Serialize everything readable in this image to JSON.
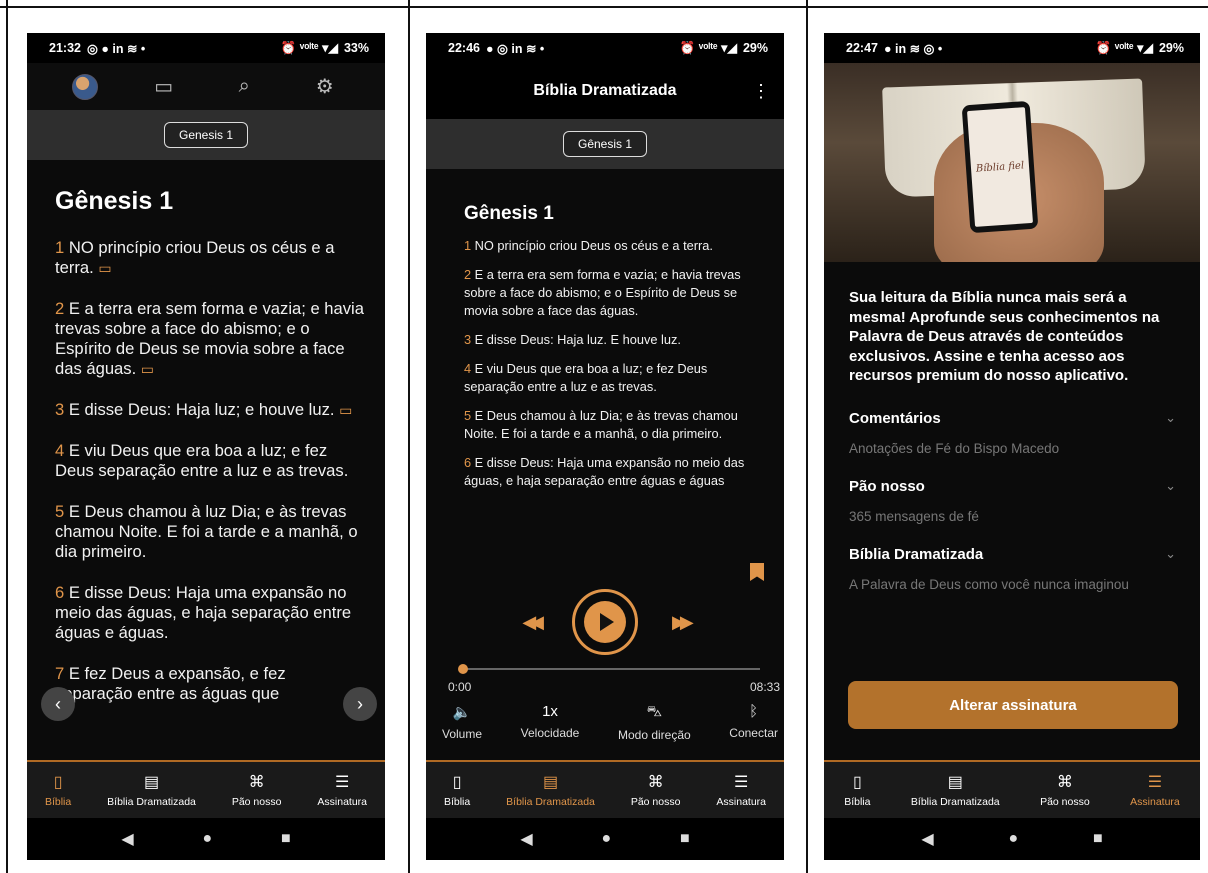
{
  "screens": {
    "biblia": {
      "status": {
        "time": "21:32",
        "icons_left": "◎ ● in ≋ •",
        "icons_right": "⏰ ᵛᵒˡᵗᵉ ▾◢",
        "battery": "33%"
      },
      "header_icons": [
        "avatar",
        "book-icon",
        "search-icon",
        "gear-icon"
      ],
      "chapter_selector": "Genesis 1",
      "heading": "Gênesis 1",
      "verses": [
        {
          "num": "1",
          "text": " NO princípio criou Deus os céus e a terra. "
        },
        {
          "num": "2",
          "text": " E a terra era sem forma e vazia; e havia trevas sobre a face do abismo; e o Espírito de Deus se movia sobre a face das águas. "
        },
        {
          "num": "3",
          "text": " E disse Deus: Haja luz; e houve luz. "
        },
        {
          "num": "4",
          "text": " E viu Deus que era boa a luz; e fez Deus separação entre a luz e as trevas."
        },
        {
          "num": "5",
          "text": " E Deus chamou à luz Dia; e às trevas chamou Noite. E foi a tarde e a manhã, o dia primeiro."
        },
        {
          "num": "6",
          "text": " E disse Deus: Haja uma expansão no meio das águas, e haja separação entre águas e águas."
        },
        {
          "num": "7",
          "text": " E fez Deus a expansão, e fez separação entre as águas que"
        }
      ],
      "prev_arrow": "‹",
      "next_arrow": "›"
    },
    "dramatizada": {
      "status": {
        "time": "22:46",
        "icons_left": "● ◎ in ≋ •",
        "icons_right": "⏰ ᵛᵒˡᵗᵉ ▾◢",
        "battery": "29%"
      },
      "title": "Bíblia Dramatizada",
      "menu": "⋮",
      "chapter_selector": "Gênesis 1",
      "heading": "Gênesis 1",
      "verses": [
        {
          "num": "1",
          "text": " NO princípio criou Deus os céus e a terra."
        },
        {
          "num": "2",
          "text": " E a terra era sem forma e vazia; e havia trevas sobre a face do abismo; e o Espírito de Deus se movia sobre a face das águas."
        },
        {
          "num": "3",
          "text": " E disse Deus: Haja luz. E houve luz."
        },
        {
          "num": "4",
          "text": " E viu Deus que era boa a luz; e fez Deus separação entre a luz e as trevas."
        },
        {
          "num": "5",
          "text": " E Deus chamou à luz Dia; e às trevas chamou Noite. E foi a tarde e a manhã, o dia primeiro."
        },
        {
          "num": "6",
          "text": " E disse Deus: Haja uma expansão no meio das águas, e haja separação entre águas e águas"
        }
      ],
      "player": {
        "rewind": "◀◀",
        "forward": "▶▶",
        "current": "0:00",
        "duration": "08:33",
        "progress": 0.0
      },
      "options": [
        {
          "icon": "🔈",
          "label": "Volume"
        },
        {
          "icon": "1x",
          "label": "Velocidade"
        },
        {
          "icon": "⛍",
          "label": "Modo direção"
        },
        {
          "icon": "ᛒ",
          "label": "Conectar"
        }
      ]
    },
    "assinatura": {
      "status": {
        "time": "22:47",
        "icons_left": "● in ≋ ◎ •",
        "icons_right": "⏰ ᵛᵒˡᵗᵉ ▾◢",
        "battery": "29%"
      },
      "hero_text": "Bíblia fiel",
      "promo": "Sua leitura da Bíblia nunca mais será a mesma! Aprofunde seus conhecimentos na Palavra de Deus através de conteúdos exclusivos. Assine e tenha acesso aos recursos premium do nosso aplicativo.",
      "accordions": [
        {
          "title": "Comentários",
          "subtitle": "Anotações de Fé do Bispo Macedo"
        },
        {
          "title": "Pão nosso",
          "subtitle": "365 mensagens de fé"
        },
        {
          "title": "Bíblia Dramatizada",
          "subtitle": "A Palavra de Deus como você nunca imaginou"
        }
      ],
      "button": "Alterar assinatura"
    }
  },
  "bottom_nav": [
    "Bíblia",
    "Bíblia Dramatizada",
    "Pão nosso",
    "Assinatura"
  ],
  "colors": {
    "accent": "#e0954a",
    "background": "#0b0b0b",
    "button": "#b3722c"
  }
}
